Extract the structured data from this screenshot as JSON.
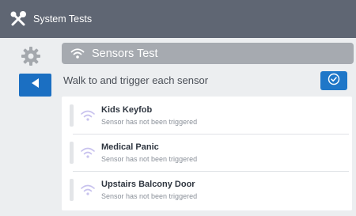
{
  "window": {
    "title": "System Tests",
    "icon": "tools-icon"
  },
  "left_rail": {
    "settings_icon": "gear-icon",
    "back_icon": "back-arrow-icon"
  },
  "section": {
    "title": "Sensors Test",
    "icon": "wifi-icon"
  },
  "instruction": "Walk to and trigger each sensor",
  "confirm_icon": "check-circle-icon",
  "sensors": [
    {
      "name": "Kids Keyfob",
      "status": "Sensor has not been triggered"
    },
    {
      "name": "Medical Panic",
      "status": "Sensor has not been triggered"
    },
    {
      "name": "Upstairs Balcony Door",
      "status": "Sensor has not been triggered"
    }
  ],
  "colors": {
    "titlebar": "#5f6673",
    "primary_button": "#1b6fc2",
    "section_header": "#a6aab0",
    "signal_icon": "#c8c2ee",
    "background": "#eceef0"
  }
}
